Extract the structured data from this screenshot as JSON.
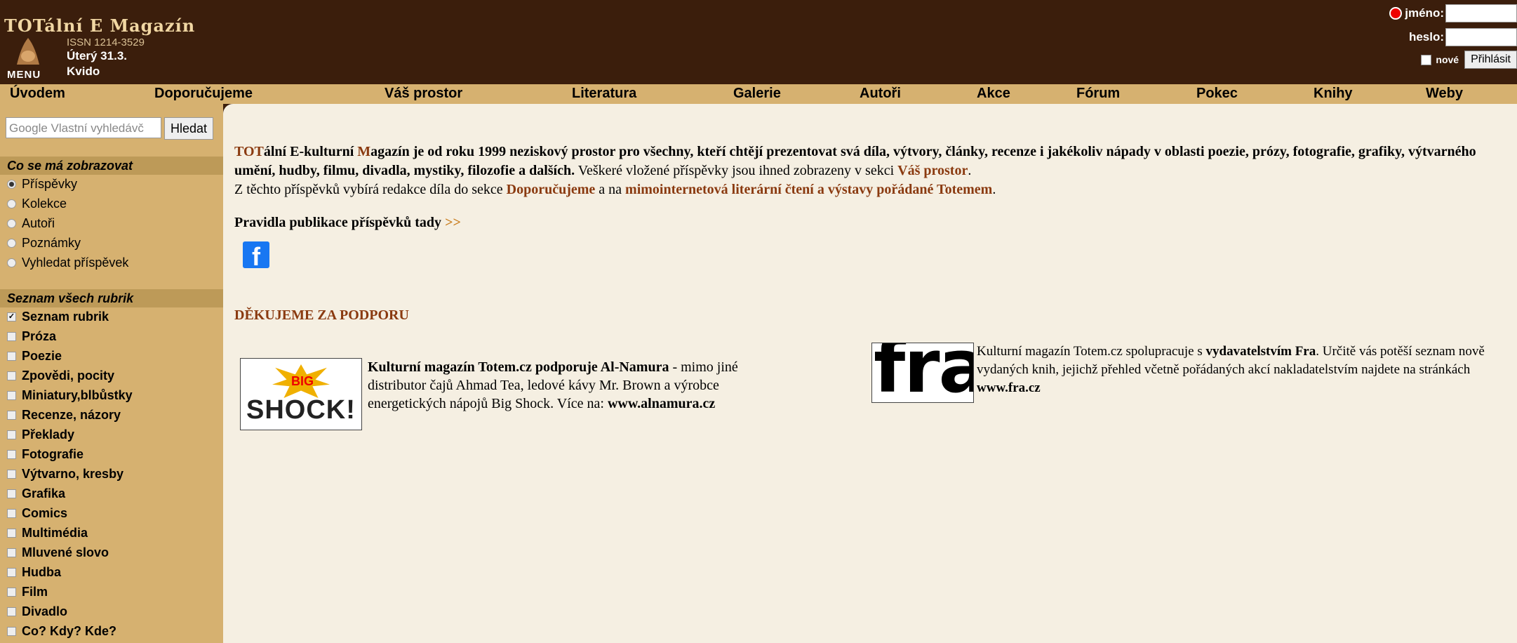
{
  "header": {
    "logo_text": "TOTální E Magazín",
    "issn": "ISSN 1214-3529",
    "date": "Úterý 31.3.",
    "nameday": "Kvido",
    "menu_label": "MENU"
  },
  "login": {
    "username_label": "jméno:",
    "password_label": "heslo:",
    "new_label": "nové",
    "login_button": "Přihlásit"
  },
  "nav": [
    "Úvodem",
    "Doporučujeme",
    "Váš prostor",
    "Literatura",
    "Galerie",
    "Autoři",
    "Akce",
    "Fórum",
    "Pokec",
    "Knihy",
    "Weby"
  ],
  "search": {
    "placeholder": "Google  Vlastní vyhledávč",
    "button": "Hledat"
  },
  "sidebar": {
    "display_heading": "Co se má zobrazovat",
    "display_options": [
      {
        "label": "Příspěvky",
        "selected": true
      },
      {
        "label": "Kolekce",
        "selected": false
      },
      {
        "label": "Autoři",
        "selected": false
      },
      {
        "label": "Poznámky",
        "selected": false
      },
      {
        "label": "Vyhledat příspěvek",
        "selected": false
      }
    ],
    "rubrics_heading": "Seznam všech rubrik",
    "rubrics": [
      {
        "label": "Seznam rubrik",
        "checked": true
      },
      {
        "label": "Próza",
        "checked": false
      },
      {
        "label": "Poezie",
        "checked": false
      },
      {
        "label": "Zpovědi, pocity",
        "checked": false
      },
      {
        "label": "Miniatury,blbůstky",
        "checked": false
      },
      {
        "label": "Recenze, názory",
        "checked": false
      },
      {
        "label": "Překlady",
        "checked": false
      },
      {
        "label": "Fotografie",
        "checked": false
      },
      {
        "label": "Výtvarno, kresby",
        "checked": false
      },
      {
        "label": "Grafika",
        "checked": false
      },
      {
        "label": "Comics",
        "checked": false
      },
      {
        "label": "Multimédia",
        "checked": false
      },
      {
        "label": "Mluvené slovo",
        "checked": false
      },
      {
        "label": "Hudba",
        "checked": false
      },
      {
        "label": "Film",
        "checked": false
      },
      {
        "label": "Divadlo",
        "checked": false
      },
      {
        "label": "Co? Kdy? Kde?",
        "checked": false
      }
    ]
  },
  "main": {
    "intro_tot": "TOT",
    "intro_part1": "ální E-kulturní ",
    "intro_m": "M",
    "intro_bold": "agazín je od roku 1999 neziskový prostor pro všechny, kteří chtějí prezentovat svá díla, výtvory, články, recenze i jakékoliv nápady v oblasti poezie, prózy, fotografie, grafiky, výtvarného umění, hudby, filmu, divadla, mystiky, filozofie a dalších.",
    "intro_normal": " Veškeré vložené příspěvky jsou ihned zobrazeny v sekci ",
    "intro_link_vas": "Váš prostor",
    "intro_line2_a": "Z těchto příspěvků vybírá redakce díla do sekce ",
    "intro_link_dop": "Doporučujeme",
    "intro_line2_b": " a na ",
    "intro_link_cteni": "mimointernetová literární čtení a výstavy pořádané Totemem",
    "rules_text": "Pravidla publikace příspěvků tady ",
    "rules_link": ">>",
    "facebook_glyph": "f",
    "thanks_heading": "DĚKUJEME ZA PODPORU",
    "partner1": {
      "logo_big": "BIG",
      "logo_shock": "SHOCK!",
      "bold": "Kulturní magazín Totem.cz podporuje Al-Namura",
      "text": " - mimo jiné distributor čajů Ahmad Tea, ledové kávy Mr. Brown a výrobce energetických nápojů Big Shock. Více na: ",
      "url": "www.alnamura.cz"
    },
    "partner2": {
      "logo": "fra",
      "text1": "Kulturní magazín Totem.cz spolupracuje s ",
      "bold": "vydavatelstvím Fra",
      "text2": ". Určitě vás potěší seznam nově vydaných knih, jejichž přehled včetně pořádaných akcí nakladatelstvím najdete na stránkách ",
      "url": "www.fra.cz"
    }
  }
}
